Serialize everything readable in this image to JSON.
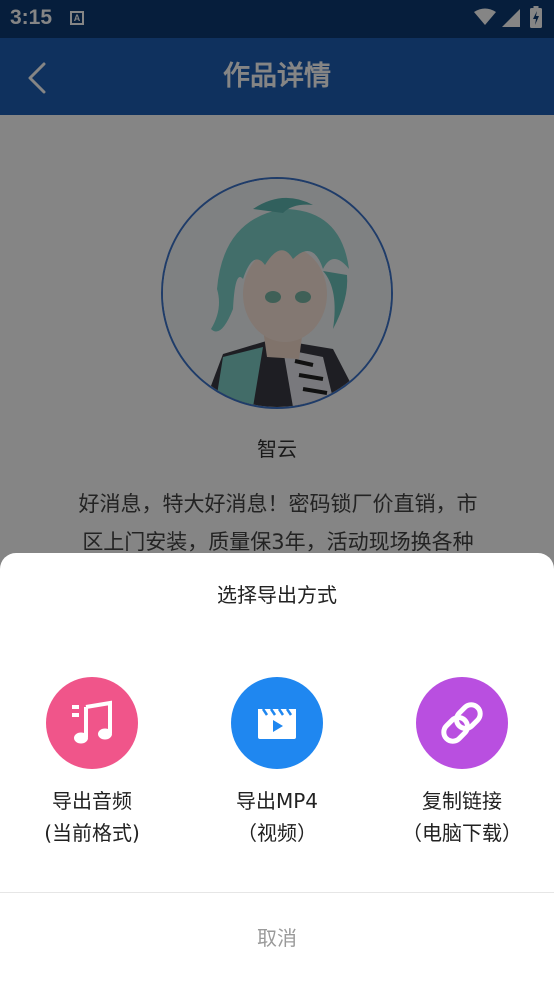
{
  "status_bar": {
    "time": "3:15",
    "notification_icon_letter": "A"
  },
  "header": {
    "title": "作品详情",
    "back_icon": "chevron-left-icon",
    "background": "#1d5fb5"
  },
  "content": {
    "author_name": "智云",
    "description_line_1": "好消息，特大好消息！密码锁厂价直销，市",
    "description_line_2": "区上门安装，质量保3年，活动现场换各种"
  },
  "sheet": {
    "title": "选择导出方式",
    "options": [
      {
        "icon": "music-note-icon",
        "color": "#f0558a",
        "label_line1": "导出音频",
        "label_line2": "(当前格式)"
      },
      {
        "icon": "video-clapper-icon",
        "color": "#1f87f0",
        "label_line1": "导出MP4",
        "label_line2": "（视频）"
      },
      {
        "icon": "link-icon",
        "color": "#b94fe0",
        "label_line1": "复制链接",
        "label_line2": "（电脑下载）"
      }
    ],
    "cancel_label": "取消"
  }
}
